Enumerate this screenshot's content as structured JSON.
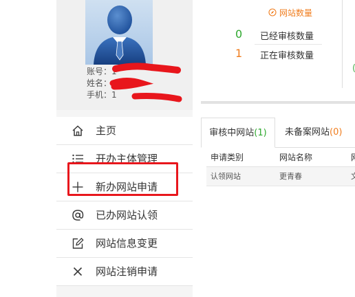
{
  "profile": {
    "account_label": "账号：",
    "account_value": "1",
    "name_label": "姓名：",
    "phone_label": "手机：",
    "phone_value": "1"
  },
  "menu": {
    "items": [
      {
        "label": "主页",
        "icon": "home-icon"
      },
      {
        "label": "开办主体管理",
        "icon": "list-icon"
      },
      {
        "label": "新办网站申请",
        "icon": "plus-icon"
      },
      {
        "label": "已办网站认领",
        "icon": "at-icon"
      },
      {
        "label": "网站信息变更",
        "icon": "edit-icon"
      },
      {
        "label": "网站注销申请",
        "icon": "close-icon"
      }
    ]
  },
  "stats": {
    "header": "网站数量",
    "header_color": "#f07d1e",
    "rows": [
      {
        "value": "0",
        "label": "已经审核数量",
        "color": "#2ea82e"
      },
      {
        "value": "1",
        "label": "正在审核数量",
        "color": "#f07d1e"
      }
    ],
    "edge_value": "("
  },
  "tabs": [
    {
      "label": "审核中网站",
      "count": "(1)"
    },
    {
      "label": "未备案网站",
      "count": "(0)"
    }
  ],
  "table": {
    "headers": [
      "申请类别",
      "网站名称",
      "网"
    ],
    "rows": [
      [
        "认领网站",
        "更青春",
        "文"
      ]
    ]
  },
  "annotation_color": "#e8161c"
}
